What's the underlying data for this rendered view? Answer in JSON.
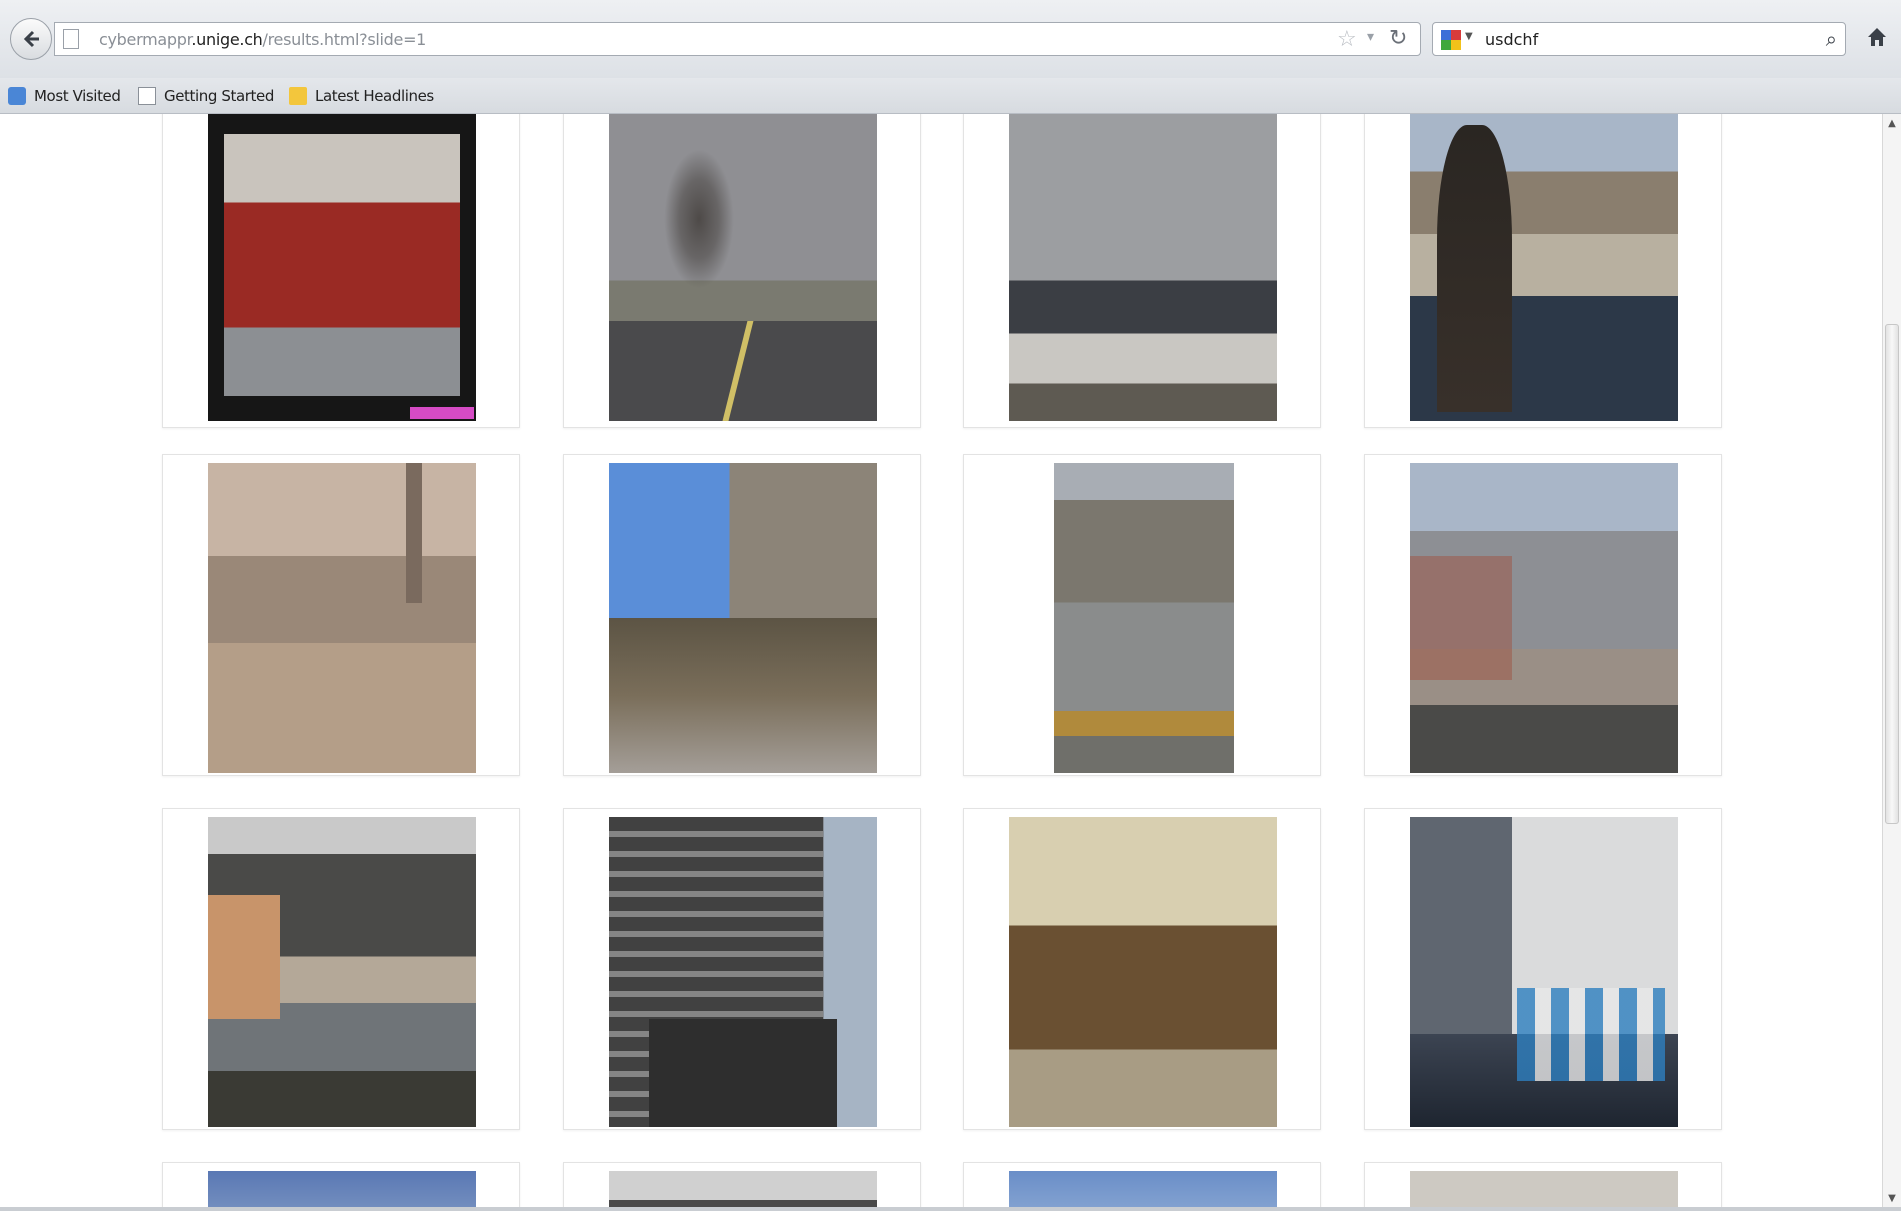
{
  "browser": {
    "url_prefix": "cybermappr",
    "url_domain": ".unige.ch",
    "url_suffix": "/results.html?slide=1",
    "search_query": "usdchf",
    "bookmarks": [
      {
        "label": "Most Visited",
        "icon": "most-visited-icon"
      },
      {
        "label": "Getting Started",
        "icon": "page-icon"
      },
      {
        "label": "Latest Headlines",
        "icon": "rss-feed-icon"
      }
    ]
  },
  "gallery": {
    "thumbnails": [
      {
        "row": 1,
        "col": 1,
        "depicts": "storefront"
      },
      {
        "row": 1,
        "col": 2,
        "depicts": "road-with-smoke"
      },
      {
        "row": 1,
        "col": 3,
        "depicts": "crowd-with-vehicles"
      },
      {
        "row": 1,
        "col": 4,
        "depicts": "man-overlooking-ruins"
      },
      {
        "row": 2,
        "col": 1,
        "depicts": "dusty-street"
      },
      {
        "row": 2,
        "col": 2,
        "depicts": "destroyed-tank"
      },
      {
        "row": 2,
        "col": 3,
        "depicts": "aerial-street"
      },
      {
        "row": 2,
        "col": 4,
        "depicts": "men-on-rubble"
      },
      {
        "row": 3,
        "col": 1,
        "depicts": "burning-street"
      },
      {
        "row": 3,
        "col": 2,
        "depicts": "truck-by-building"
      },
      {
        "row": 3,
        "col": 3,
        "depicts": "burnt-building"
      },
      {
        "row": 3,
        "col": 4,
        "depicts": "flooded-street"
      }
    ]
  },
  "colors": {
    "toolbar_bg": "#dde1e6",
    "page_bg": "#ffffff",
    "card_border": "#e3e3e3"
  }
}
